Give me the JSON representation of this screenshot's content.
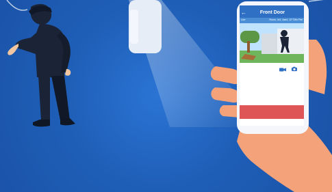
{
  "phone": {
    "title": "Front Door",
    "status_left": "Live",
    "status_right": "Room, 4x1, 4ae4, 12° BHz Fire"
  },
  "colors": {
    "background": "#1f5fb8",
    "app_header": "#2f6fc4",
    "app_status_bar": "#4a8fd6",
    "alert_bar": "#df5656",
    "intruder": "#1b2436",
    "hand_skin": "#f3a27a",
    "sensor_panel": "#e7edf7"
  },
  "icons": {
    "back": "back-arrow-icon",
    "video": "video-camera-icon",
    "camera": "photo-camera-icon"
  }
}
